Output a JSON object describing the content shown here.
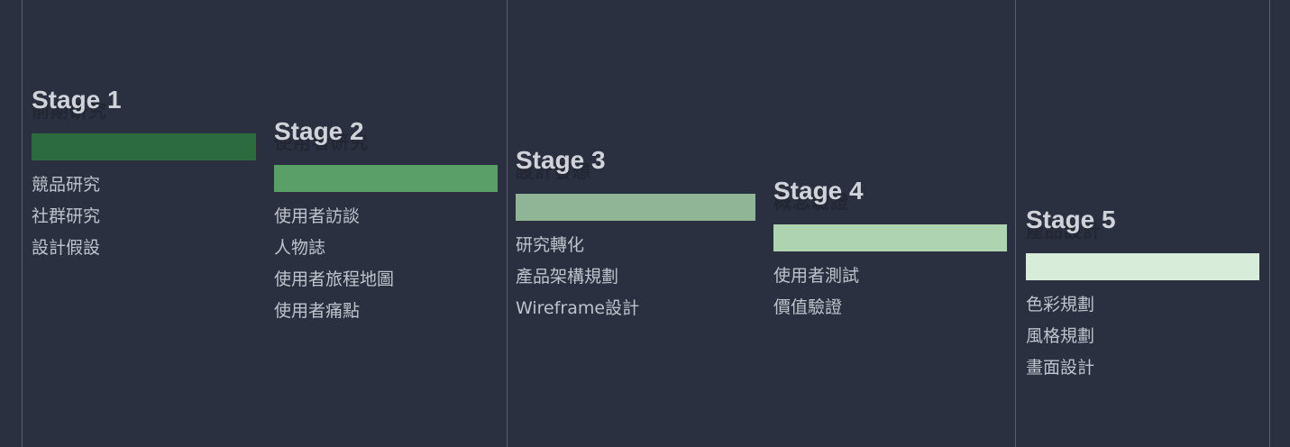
{
  "stages": [
    {
      "title": "Stage 1",
      "subtitle": "前期研究",
      "color": "#2b6b3f",
      "items": [
        "競品研究",
        "社群研究",
        "設計假設"
      ]
    },
    {
      "title": "Stage 2",
      "subtitle": "使用者研究",
      "color": "#5a9e68",
      "items": [
        "使用者訪談",
        "人物誌",
        "使用者旅程地圖",
        "使用者痛點"
      ]
    },
    {
      "title": "Stage 3",
      "subtitle": "設計發想",
      "color": "#8fb496",
      "items": [
        "研究轉化",
        "產品架構規劃",
        "Wireframe設計"
      ]
    },
    {
      "title": "Stage 4",
      "subtitle": "概念驗證",
      "color": "#add3b1",
      "items": [
        "使用者測試",
        "價值驗證"
      ]
    },
    {
      "title": "Stage 5",
      "subtitle": "產品設計",
      "color": "#d7ecd9",
      "items": [
        "色彩規劃",
        "風格規劃",
        "畫面設計"
      ]
    }
  ]
}
